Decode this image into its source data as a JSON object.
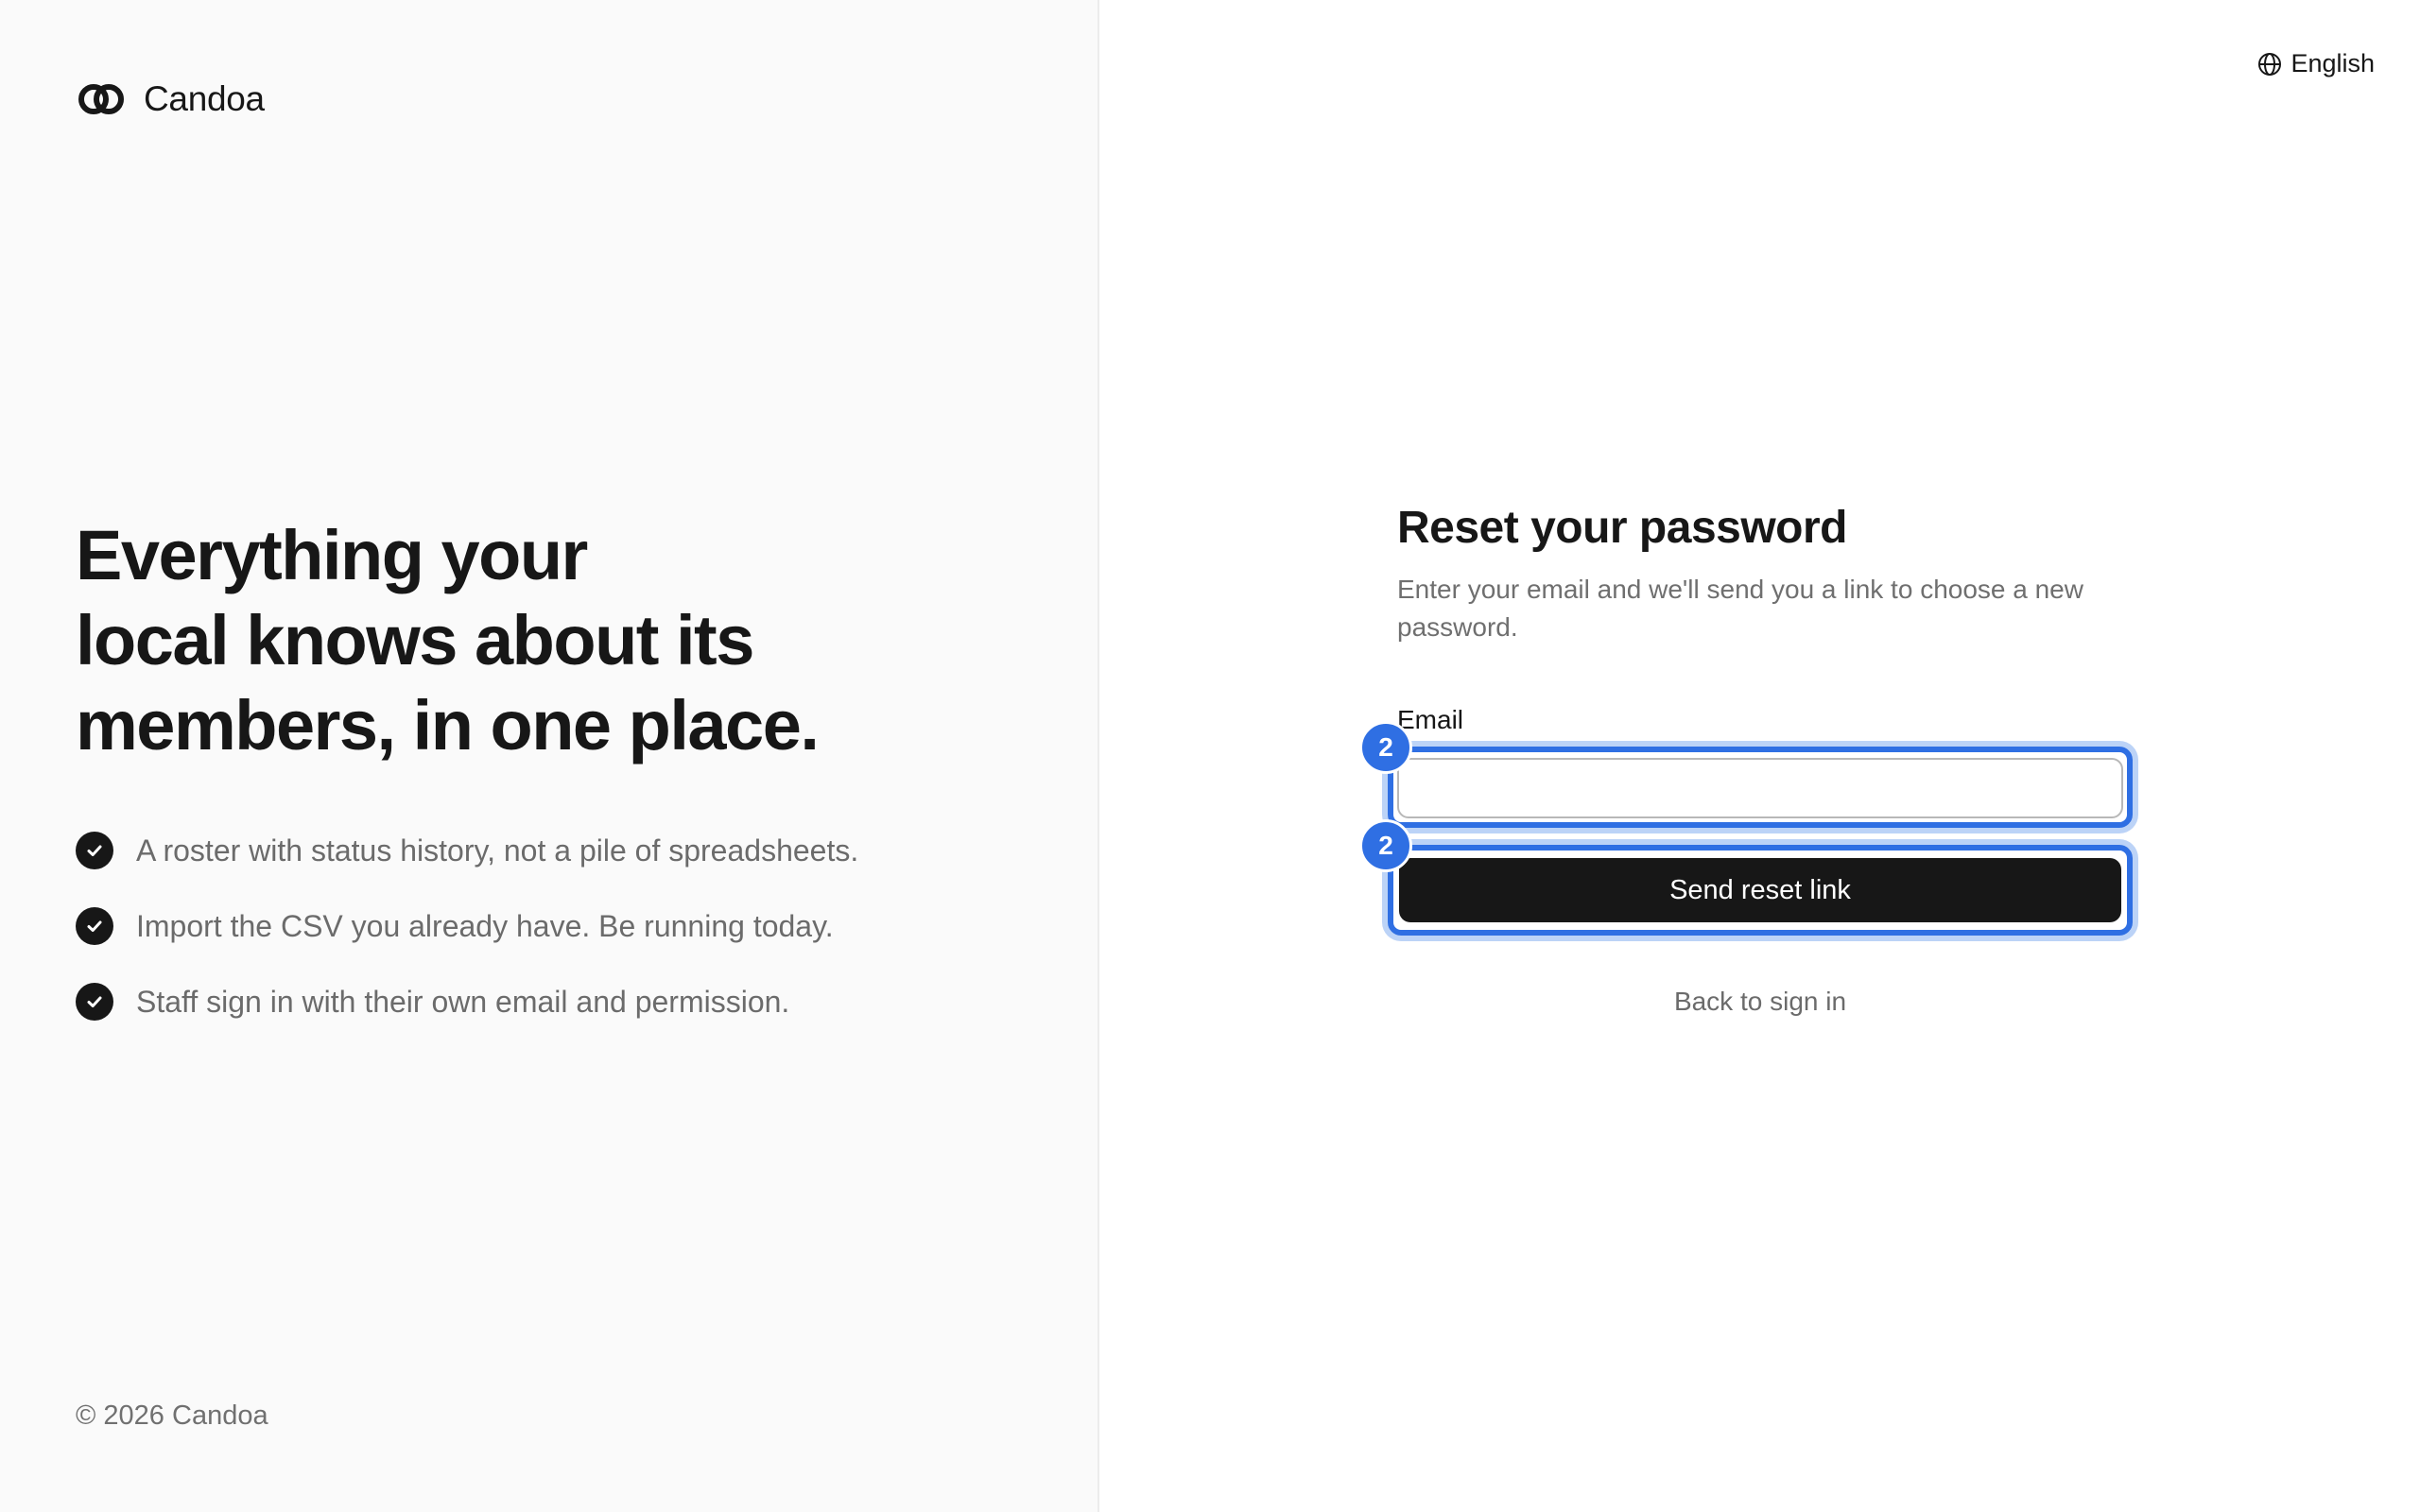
{
  "brand": {
    "name": "Candoa",
    "logo_icon": "candoa-logo-icon"
  },
  "hero": {
    "headline_lines": [
      "Everything your",
      "local knows about its",
      "members, in one place."
    ],
    "features": [
      {
        "icon": "check-circle-icon",
        "text": "A roster with status history, not a pile of spreadsheets."
      },
      {
        "icon": "check-circle-icon",
        "text": "Import the CSV you already have. Be running today."
      },
      {
        "icon": "check-circle-icon",
        "text": "Staff sign in with their own email and permission."
      }
    ]
  },
  "footer": {
    "copyright": "© 2026 Candoa"
  },
  "language": {
    "icon": "globe-icon",
    "label": "English"
  },
  "reset_form": {
    "title": "Reset your password",
    "subtitle": "Enter your email and we'll send you a link to choose a new password.",
    "email_label": "Email",
    "email_value": "",
    "email_placeholder": "",
    "submit_label": "Send reset link",
    "back_link": "Back to sign in"
  },
  "annotations": {
    "email_badge": "2",
    "submit_badge": "2",
    "highlight_color": "#2f6fe3"
  },
  "colors": {
    "accent_dark": "#171717",
    "muted_text": "#6b6b6b",
    "left_panel_bg": "#fafafa"
  }
}
